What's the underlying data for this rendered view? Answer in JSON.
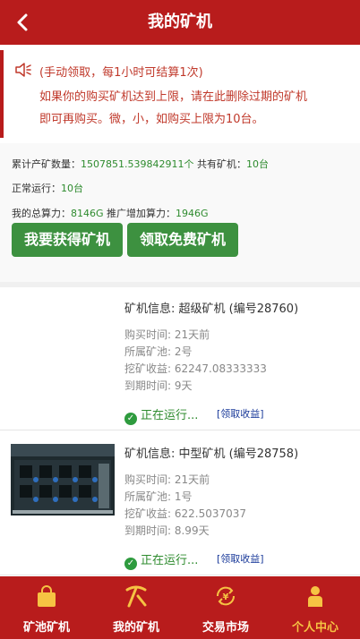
{
  "header": {
    "title": "我的矿机"
  },
  "notice": {
    "line1": "(手动领取，每1小时可结算1次)",
    "line2": "如果你的购买矿机达到上限，请在此删除过期的矿机",
    "line3": "即可再购买。微，小，如购买上限为10台。"
  },
  "stats": {
    "total_label": "累计产矿数量：",
    "total_value": "1507851.539842911个",
    "count_label": " 共有矿机：",
    "count_value": "10台",
    "running_label": "正常运行：",
    "running_value": "10台",
    "power_label": "我的总算力：",
    "power_value": "8146G",
    "promo_label": " 推广增加算力：",
    "promo_value": "1946G"
  },
  "buttons": {
    "get_miner": "我要获得矿机",
    "free_miner": "领取免费矿机"
  },
  "miners": [
    {
      "title": "矿机信息: 超级矿机 (编号28760)",
      "bought": "购买时间: 21天前",
      "pool": "所属矿池: 2号",
      "earnings": "挖矿收益: 62247.08333333",
      "expires": "到期时间: 9天",
      "status": "正在运行...",
      "claim": "[领取收益]"
    },
    {
      "title": "矿机信息: 中型矿机 (编号28758)",
      "bought": "购买时间: 21天前",
      "pool": "所属矿池: 1号",
      "earnings": "挖矿收益: 622.5037037",
      "expires": "到期时间: 8.99天",
      "status": "正在运行...",
      "claim": "[领取收益]"
    }
  ],
  "tabs": [
    {
      "label": "矿池矿机",
      "icon": "shopping-bag-icon"
    },
    {
      "label": "我的矿机",
      "icon": "pickaxe-icon"
    },
    {
      "label": "交易市场",
      "icon": "yuan-exchange-icon"
    },
    {
      "label": "个人中心",
      "icon": "person-icon",
      "active": true
    }
  ],
  "colors": {
    "brand_red": "#b81c1c",
    "button_green": "#3d9140",
    "active_tab": "#f6c343"
  }
}
